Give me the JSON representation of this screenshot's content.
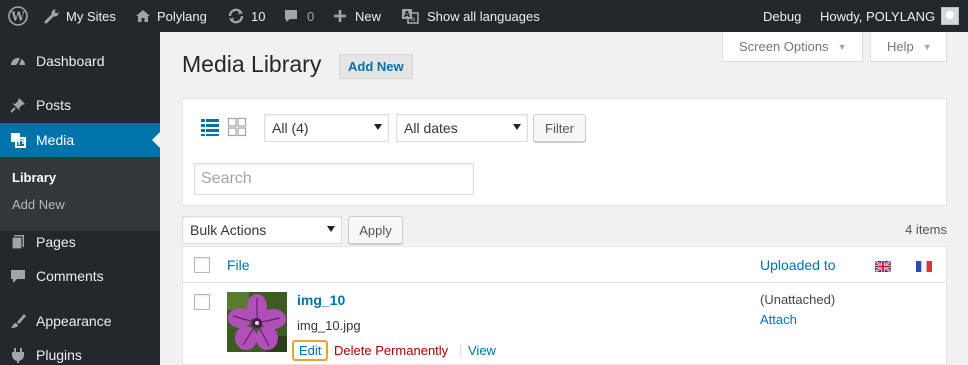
{
  "adminbar": {
    "wp_logo": "wordpress-icon",
    "my_sites": "My Sites",
    "site_name": "Polylang",
    "updates_count": "10",
    "comments_count": "0",
    "new_label": "New",
    "languages_label": "Show all languages",
    "debug_label": "Debug",
    "howdy": "Howdy, POLYLANG"
  },
  "sidebar": {
    "items": [
      {
        "label": "Dashboard",
        "icon": "dashboard-icon"
      },
      {
        "label": "Posts",
        "icon": "pin-icon"
      },
      {
        "label": "Media",
        "icon": "media-icon"
      },
      {
        "label": "Pages",
        "icon": "pages-icon"
      },
      {
        "label": "Comments",
        "icon": "comment-icon"
      },
      {
        "label": "Appearance",
        "icon": "brush-icon"
      },
      {
        "label": "Plugins",
        "icon": "plugin-icon"
      }
    ],
    "submenu": [
      {
        "label": "Library"
      },
      {
        "label": "Add New"
      }
    ]
  },
  "screen_options": "Screen Options",
  "help": "Help",
  "page": {
    "title": "Media Library",
    "add_new": "Add New"
  },
  "filters": {
    "type_select": "All (4)",
    "date_select": "All dates",
    "filter_button": "Filter",
    "search_placeholder": "Search"
  },
  "bulk": {
    "select": "Bulk Actions",
    "apply": "Apply",
    "items_count": "4 items"
  },
  "table": {
    "columns": {
      "file": "File",
      "uploaded_to": "Uploaded to"
    },
    "rows": [
      {
        "title": "img_10",
        "filename": "img_10.jpg",
        "uploaded_to": "(Unattached)",
        "attach": "Attach",
        "actions": {
          "edit": "Edit",
          "delete": "Delete Permanently",
          "view": "View"
        }
      }
    ]
  },
  "colors": {
    "accent": "#0073aa",
    "adminbar": "#23282d",
    "delete": "#a00"
  }
}
